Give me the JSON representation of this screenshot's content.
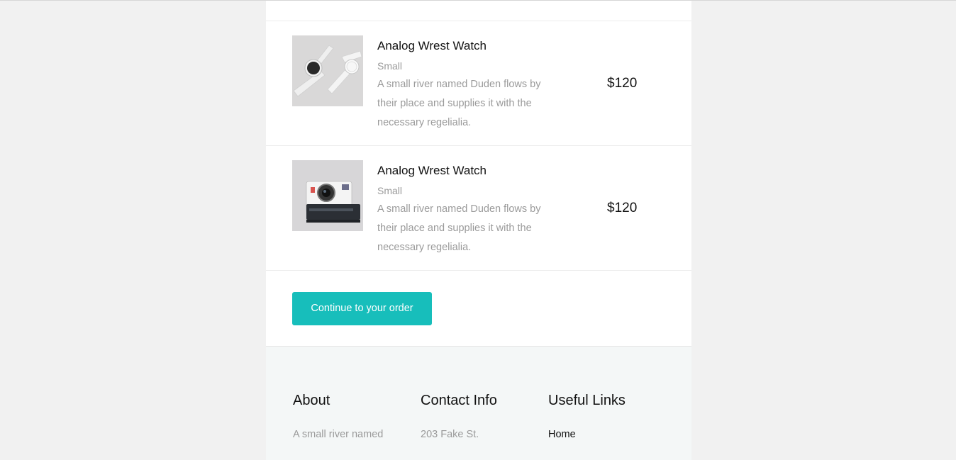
{
  "items": [
    {
      "name": "Analog Wrest Watch",
      "size": "Small",
      "description": "A small river named Duden flows by their place and supplies it with the necessary regelialia.",
      "price": "$120",
      "image": "watch"
    },
    {
      "name": "Analog Wrest Watch",
      "size": "Small",
      "description": "A small river named Duden flows by their place and supplies it with the necessary regelialia.",
      "price": "$120",
      "image": "camera"
    }
  ],
  "cta": {
    "label": "Continue to your order",
    "color": "#17bebb"
  },
  "footer": {
    "about": {
      "title": "About",
      "text": "A small river named"
    },
    "contact": {
      "title": "Contact Info",
      "text": "203 Fake St."
    },
    "links": {
      "title": "Useful Links",
      "first": "Home"
    }
  }
}
